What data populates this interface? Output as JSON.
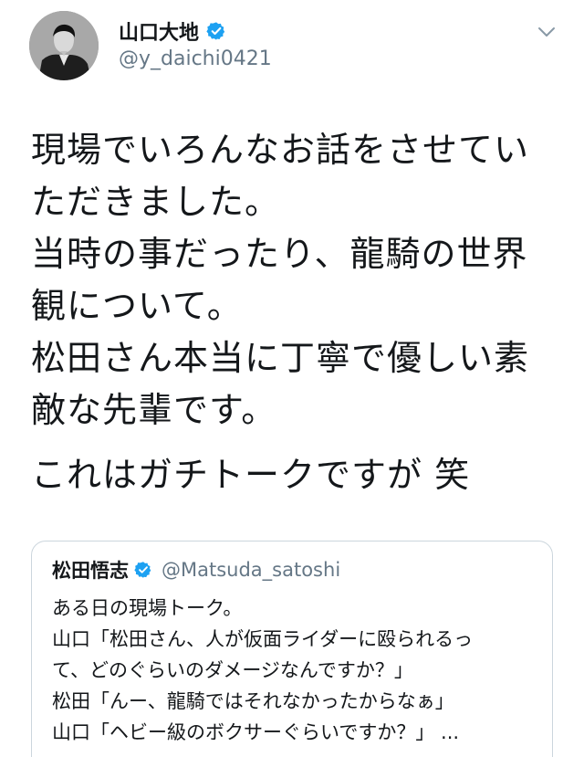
{
  "author": {
    "display_name": "山口大地",
    "handle": "@y_daichi0421",
    "verified": true,
    "avatar": "profile-photo"
  },
  "menu": {
    "icon": "chevron-down-icon"
  },
  "tweet": {
    "lines": [
      "現場でいろんなお話をさせてい",
      "ただきました。",
      "当時の事だったり、龍騎の世界",
      "観について。",
      "松田さん本当に丁寧で優しい素",
      "敵な先輩です。"
    ],
    "last_line": "これはガチトークですが 笑"
  },
  "quoted_tweet": {
    "display_name": "松田悟志",
    "handle": "@Matsuda_satoshi",
    "verified": true,
    "lines": [
      "ある日の現場トーク。",
      "山口「松田さん、人が仮面ライダーに殴られるっ",
      "て、どのぐらいのダメージなんですか？」",
      "松田「んー、龍騎ではそれなかったからなぁ」",
      "山口「ヘビー級のボクサーぐらいですか？」 ..."
    ]
  },
  "colors": {
    "text": "#14171a",
    "secondary_text": "#657786",
    "verified_badge": "#1da1f2",
    "border": "#ccd6dd"
  }
}
